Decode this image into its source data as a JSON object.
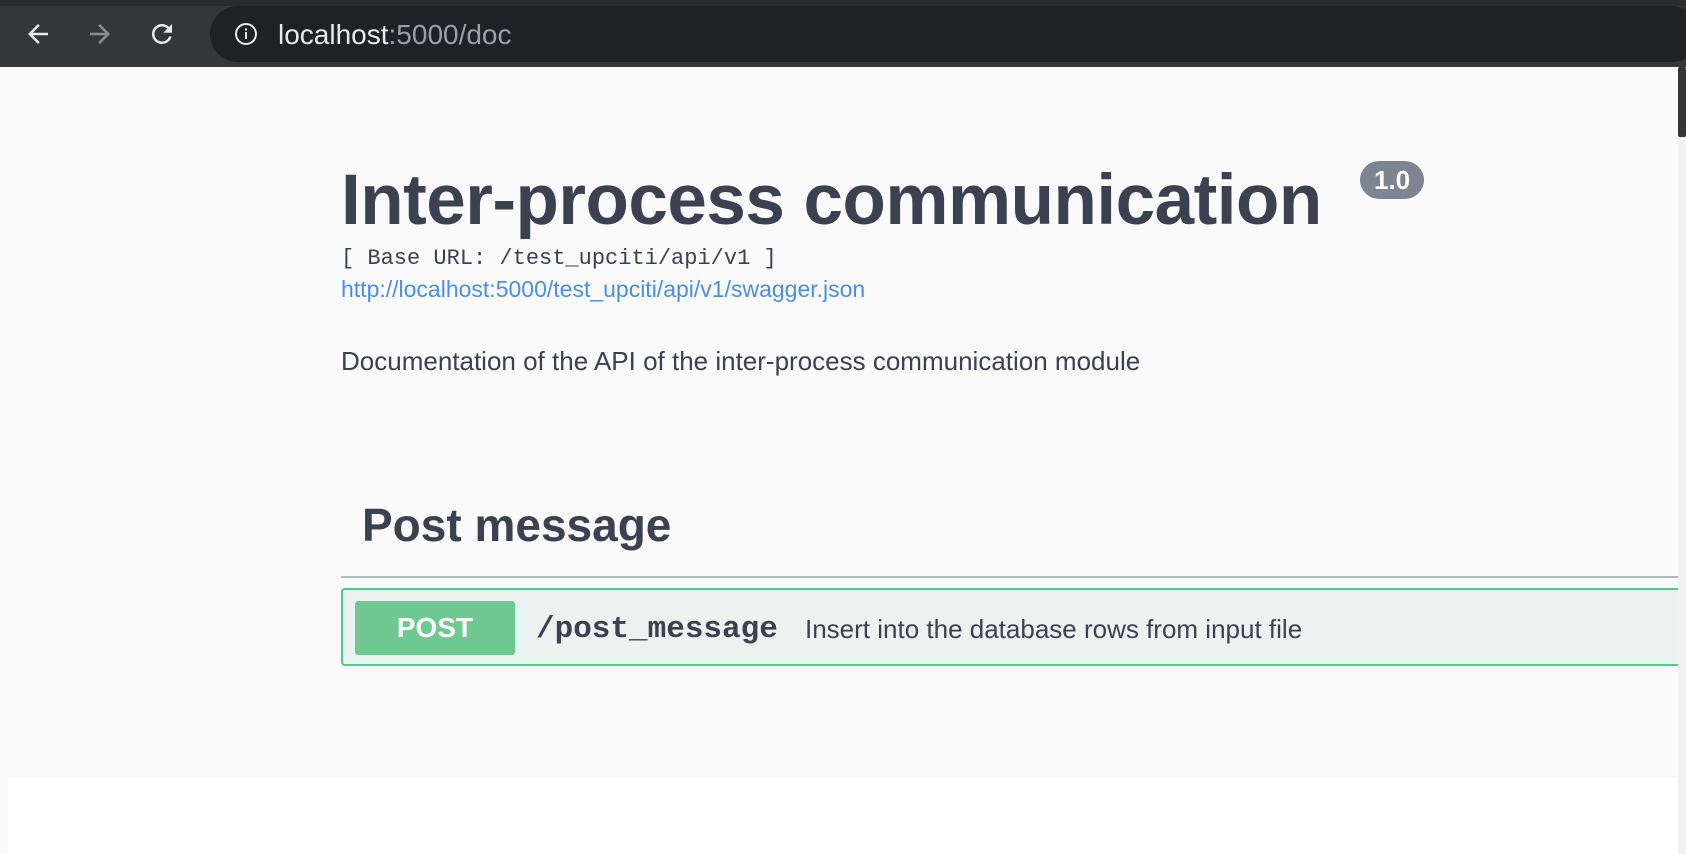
{
  "browser": {
    "url_host": "localhost",
    "url_rest": ":5000/doc",
    "icons": [
      "back-arrow-icon",
      "forward-arrow-icon",
      "reload-icon",
      "info-icon"
    ]
  },
  "page": {
    "title": "Inter-process communication",
    "version": "1.0",
    "base_url": "[ Base URL: /test_upciti/api/v1 ]",
    "spec_link": "http://localhost:5000/test_upciti/api/v1/swagger.json",
    "description": "Documentation of the API of the inter-process communication module"
  },
  "tag": {
    "name": "Post message",
    "operations": [
      {
        "method": "POST",
        "path": "/post_message",
        "summary": "Insert into the database rows from input file"
      }
    ]
  },
  "colors": {
    "post_method_bg": "#6ec892",
    "post_block_border": "#49cc90",
    "post_block_bg": "#ebf3f0",
    "link": "#4990e2",
    "text": "#3b4151",
    "version_badge": "#7d8492"
  }
}
